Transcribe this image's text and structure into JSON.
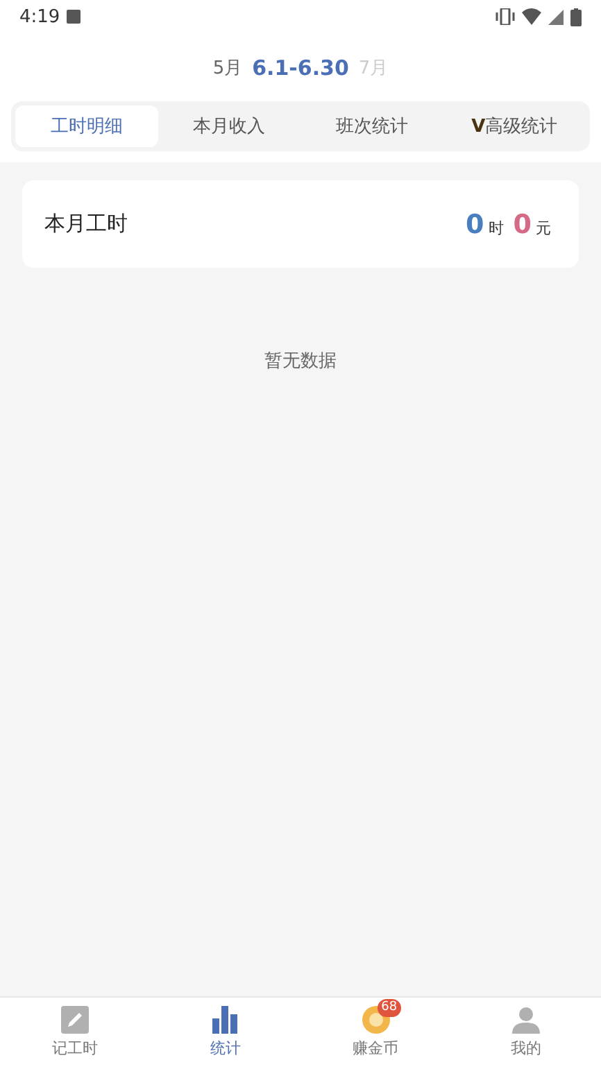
{
  "status_bar": {
    "time": "4:19"
  },
  "month_nav": {
    "previous": "5月",
    "current": "6.1-6.30",
    "next": "7月"
  },
  "tabs": [
    {
      "label": "工时明细",
      "selected": true
    },
    {
      "label": "本月收入",
      "selected": false
    },
    {
      "label": "班次统计",
      "selected": false
    },
    {
      "label": "**V**高级统计",
      "selected": false
    }
  ],
  "summary": {
    "title": "本月工时",
    "hours": "0",
    "hours_unit": "时",
    "amount": "0",
    "amount_unit": "元"
  },
  "empty_message": "暂无数据",
  "bottom_nav": [
    {
      "label": "记工时",
      "kind": "pencil",
      "selected": false
    },
    {
      "label": "统计",
      "kind": "chart",
      "selected": true
    },
    {
      "label": "赚金币",
      "kind": "coin",
      "selected": false,
      "badge": "68"
    },
    {
      "label": "我的",
      "kind": "person",
      "selected": false
    }
  ]
}
